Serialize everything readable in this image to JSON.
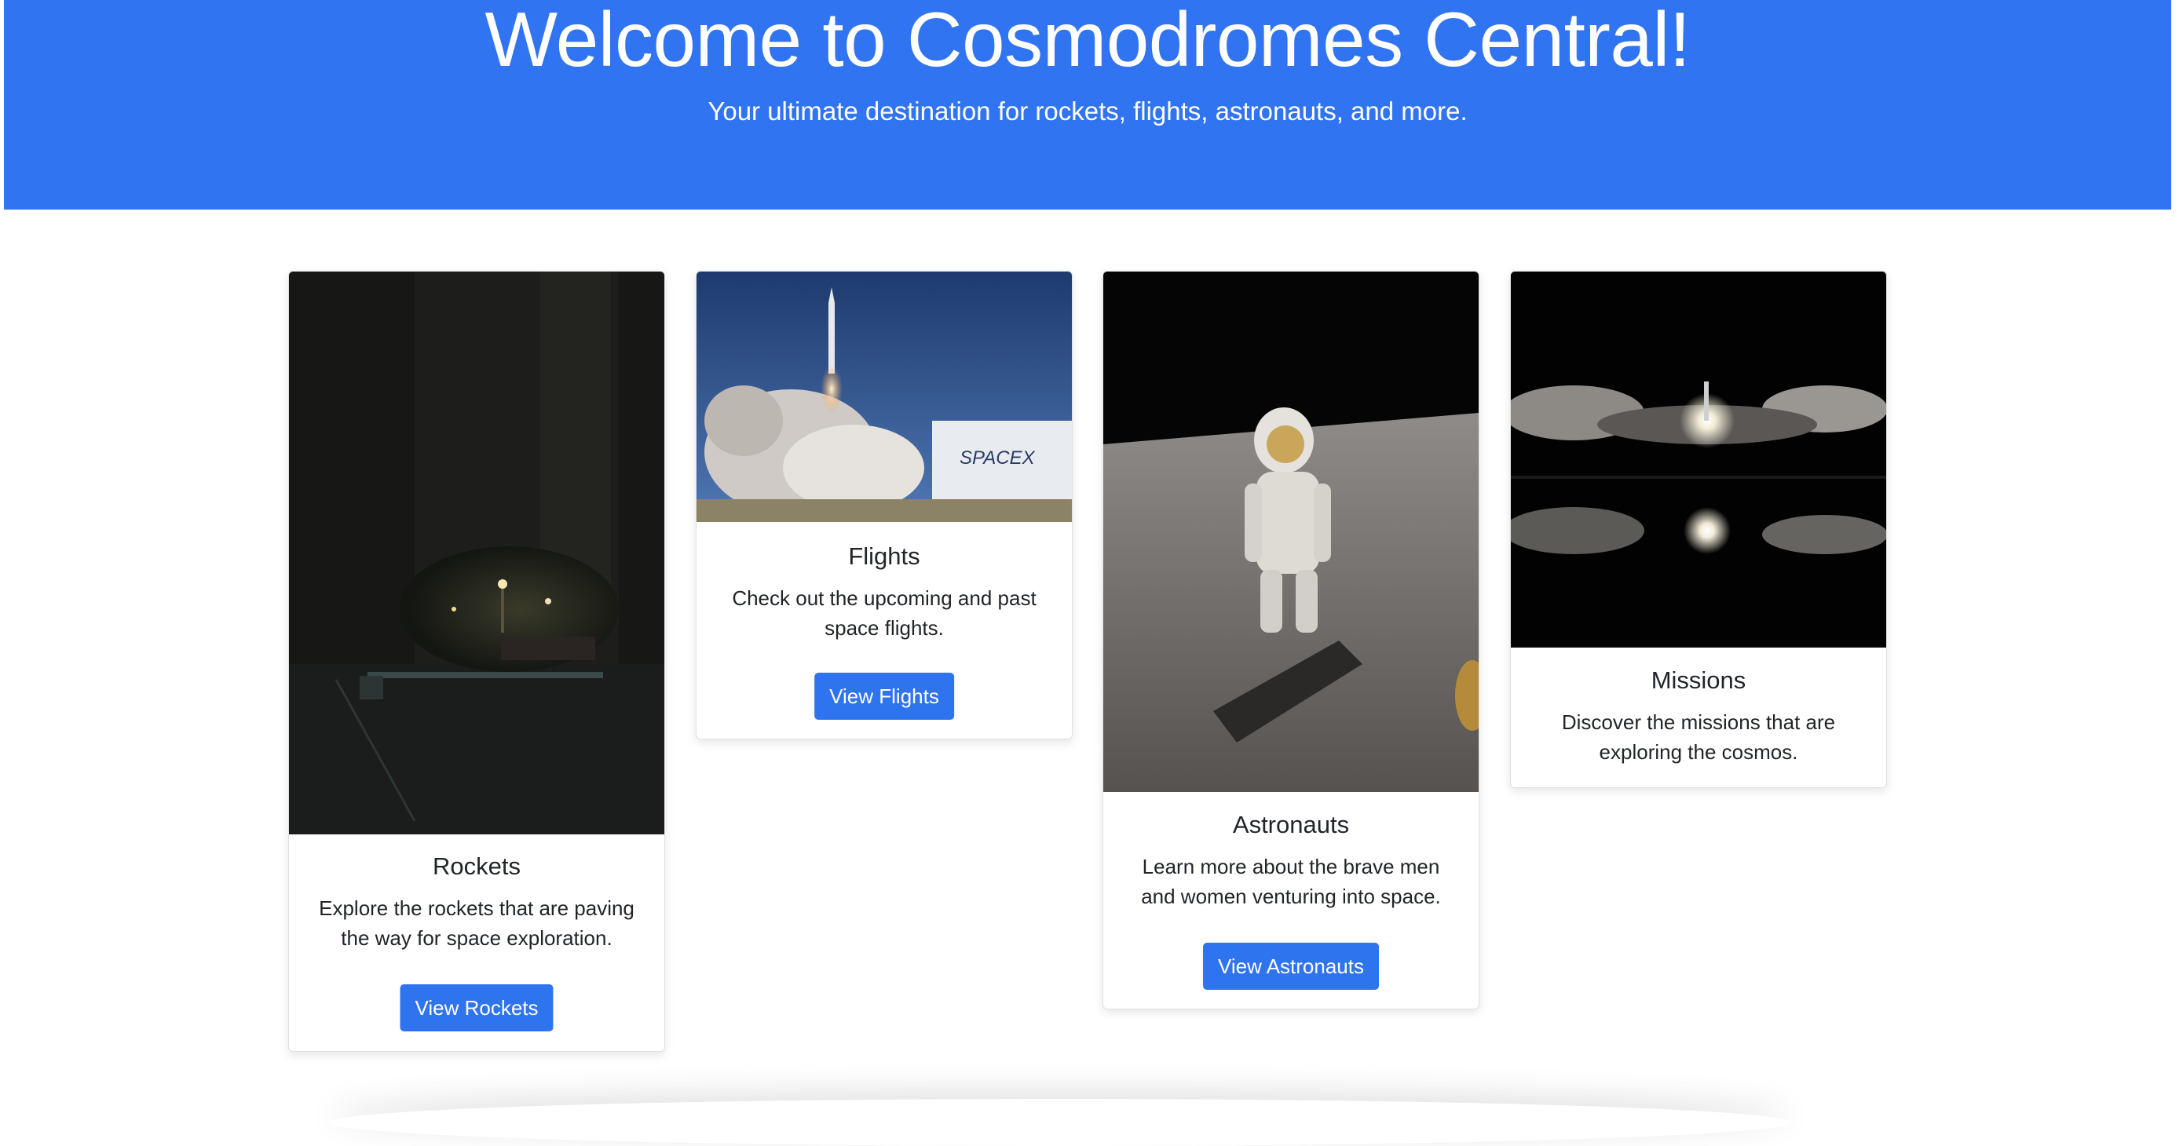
{
  "hero": {
    "title": "Welcome to Cosmodromes Central!",
    "subtitle": "Your ultimate destination for rockets, flights, astronauts, and more."
  },
  "cards": [
    {
      "title": "Rockets",
      "text": "Explore the rockets that are paving the way for space exploration.",
      "button": "View Rockets",
      "image": "night-launch-site-photo"
    },
    {
      "title": "Flights",
      "text": "Check out the upcoming and past space flights.",
      "button": "View Flights",
      "image": "spacex-launch-photo"
    },
    {
      "title": "Astronauts",
      "text": "Learn more about the brave men and women venturing into space.",
      "button": "View Astronauts",
      "image": "astronaut-on-moon-photo"
    },
    {
      "title": "Missions",
      "text": "Discover the missions that are exploring the cosmos.",
      "image": "night-launch-reflection-photo"
    }
  ],
  "colors": {
    "primary": "#3174f1",
    "button": "#2f74ef"
  }
}
